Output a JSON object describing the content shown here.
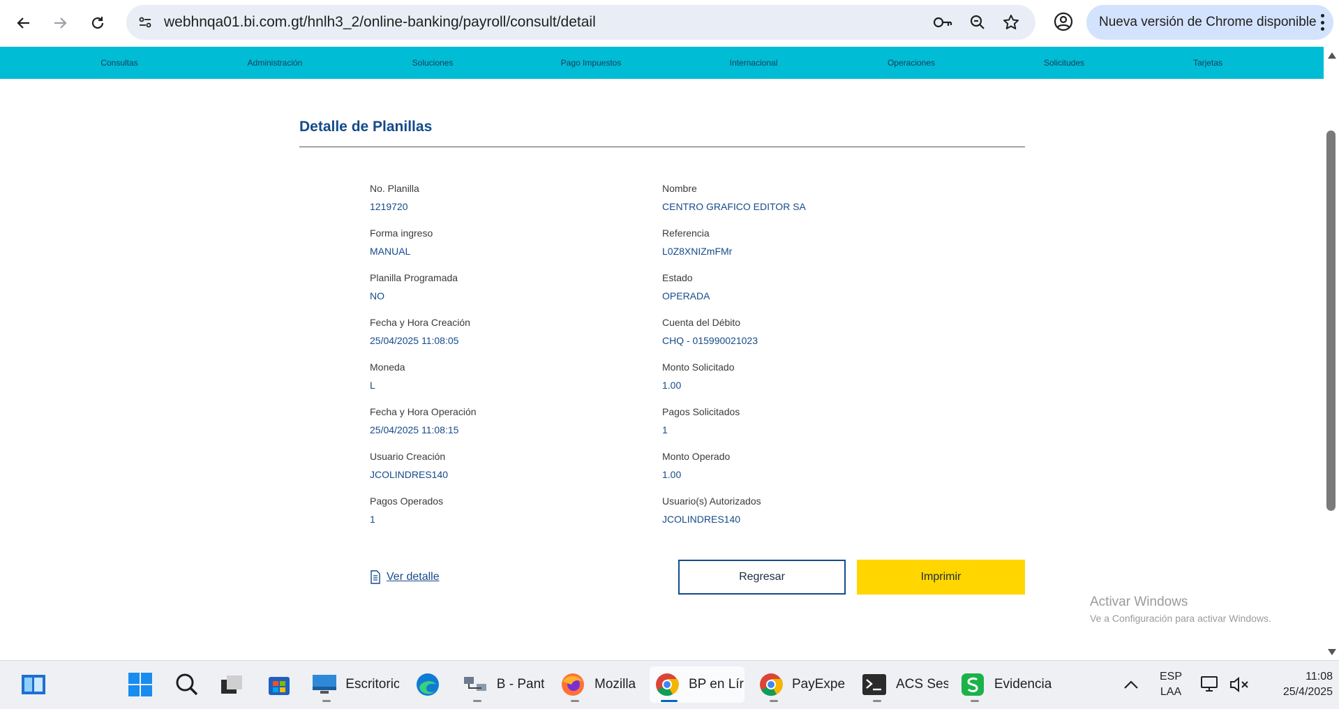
{
  "browser": {
    "url": "webhnqa01.bi.com.gt/hnlh3_2/online-banking/payroll/consult/detail",
    "update_label": "Nueva versión de Chrome disponible"
  },
  "nav": {
    "items": [
      "Consultas",
      "Administración",
      "Soluciones",
      "Pago Impuestos",
      "Internacional",
      "Operaciones",
      "Solicitudes",
      "Tarjetas"
    ]
  },
  "page": {
    "title": "Detalle de Planillas",
    "left_fields": [
      {
        "label": "No. Planilla",
        "value": "1219720"
      },
      {
        "label": "Forma ingreso",
        "value": "MANUAL"
      },
      {
        "label": "Planilla Programada",
        "value": "NO"
      },
      {
        "label": "Fecha y Hora Creación",
        "value": "25/04/2025 11:08:05"
      },
      {
        "label": "Moneda",
        "value": "L"
      },
      {
        "label": "Fecha y Hora Operación",
        "value": "25/04/2025 11:08:15"
      },
      {
        "label": "Usuario Creación",
        "value": "JCOLINDRES140"
      },
      {
        "label": "Pagos Operados",
        "value": "1"
      }
    ],
    "right_fields": [
      {
        "label": "Nombre",
        "value": "CENTRO GRAFICO EDITOR SA"
      },
      {
        "label": "Referencia",
        "value": "L0Z8XNIZmFMr"
      },
      {
        "label": "Estado",
        "value": "OPERADA"
      },
      {
        "label": "Cuenta del Débito",
        "value": "CHQ - 015990021023"
      },
      {
        "label": "Monto Solicitado",
        "value": "1.00"
      },
      {
        "label": "Pagos Solicitados",
        "value": "1"
      },
      {
        "label": "Monto Operado",
        "value": "1.00"
      },
      {
        "label": "Usuario(s) Autorizados",
        "value": "JCOLINDRES140"
      }
    ],
    "ver_detalle": "Ver detalle",
    "btn_regresar": "Regresar",
    "btn_imprimir": "Imprimir"
  },
  "watermark": {
    "line1": "Activar Windows",
    "line2": "Ve a Configuración para activar Windows."
  },
  "taskbar": {
    "apps": [
      {
        "name": "Escritoric",
        "icon": "desktop-icon"
      },
      {
        "name": "",
        "icon": "edge-icon"
      },
      {
        "name": "B - Pant",
        "icon": "network-icon"
      },
      {
        "name": "Mozilla",
        "icon": "firefox-icon"
      },
      {
        "name": "BP en Lír",
        "icon": "chrome-icon"
      },
      {
        "name": "PayExpec",
        "icon": "chrome-icon"
      },
      {
        "name": "ACS Ses",
        "icon": "terminal-icon"
      },
      {
        "name": "Evidencia",
        "icon": "sheets-icon"
      }
    ],
    "lang_top": "ESP",
    "lang_bottom": "LAA",
    "time": "11:08",
    "date": "25/4/2025"
  }
}
